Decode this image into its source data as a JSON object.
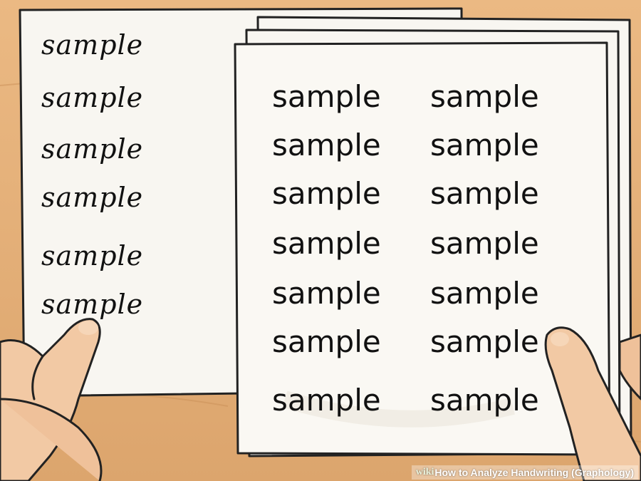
{
  "left_sheet": {
    "words": [
      "sample",
      "sample",
      "sample",
      "sample",
      "sample",
      "sample"
    ]
  },
  "right_sheet": {
    "col1": [
      "sample",
      "sample",
      "sample",
      "sample",
      "sample",
      "sample",
      "sample"
    ],
    "col2": [
      "sample",
      "sample",
      "sample",
      "sample",
      "sample",
      "sample",
      "sample"
    ]
  },
  "watermark": {
    "brand": "wiki",
    "how": "How",
    "title": "to Analyze Handwriting (Graphology)"
  },
  "colors": {
    "table": "#e6b27a",
    "paper": "#f9f7f2",
    "ink": "#111111",
    "skin": "#f2c9a4"
  }
}
